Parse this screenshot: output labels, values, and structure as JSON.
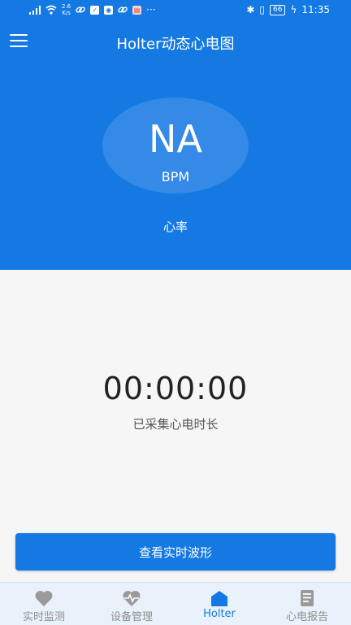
{
  "status_bar": {
    "net_speed_value": "2.6",
    "net_speed_unit": "K/s",
    "more": "···",
    "battery": "66",
    "time": "11:35"
  },
  "header": {
    "title": "Holter动态心电图",
    "heart_rate_value": "NA",
    "heart_rate_unit": "BPM",
    "heart_rate_label": "心率"
  },
  "main": {
    "timer": "00:00:00",
    "timer_label": "已采集心电时长",
    "view_button_label": "查看实时波形"
  },
  "tabs": [
    {
      "label": "实时监测",
      "icon": "heart-icon"
    },
    {
      "label": "设备管理",
      "icon": "device-icon"
    },
    {
      "label": "Holter",
      "icon": "home-icon",
      "active": true
    },
    {
      "label": "心电报告",
      "icon": "report-icon"
    }
  ],
  "colors": {
    "primary": "#1479e2",
    "circle": "#3589e7",
    "tab_inactive": "#8e8e8e",
    "background": "#f6f6f6"
  }
}
